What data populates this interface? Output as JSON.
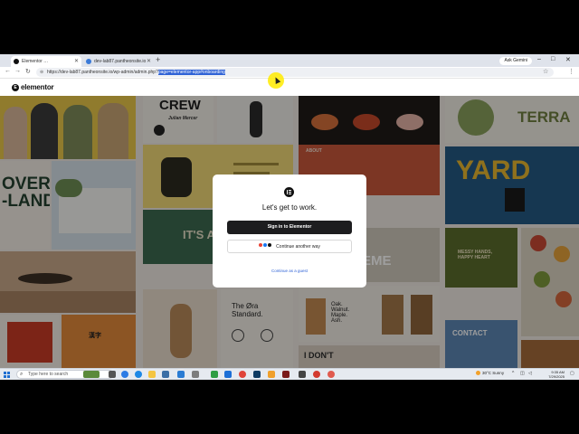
{
  "browser": {
    "tabs": [
      {
        "title": "Elementor …",
        "active": true
      },
      {
        "title": "dev-lab87.pantheonsite.io",
        "active": false
      }
    ],
    "new_tab": "+",
    "gemini_label": "Ask Gemini",
    "url_prefix": "https://dev-lab87.pantheonsite.io/wp-admin/admin.php?",
    "url_selected": "page=elementor-app#onboarding",
    "window_controls": [
      "–",
      "□",
      "✕"
    ],
    "nav": {
      "back": "←",
      "forward": "→",
      "reload": "↻",
      "star": "☆",
      "menu": "⋮"
    }
  },
  "app": {
    "logo_glyph": "E",
    "logo_text": "elementor"
  },
  "mosaic": {
    "texts": {
      "crew": "CREW",
      "crew_name": "Julian Mercer",
      "over_land": "OVER\n-LAND",
      "its_all": "IT'S ALL",
      "about": "ABOUT",
      "eme": "EME",
      "terra": "TERRA",
      "yard": "YARD",
      "messy": "MESSY HANDS,\nHAPPY HEART",
      "contact": "CONTACT",
      "oak": "Oak.\nWalnut.\nMaple.\nAsh.",
      "ora": "The Øra\nStandard.",
      "dont": "I DON'T"
    }
  },
  "modal": {
    "title": "Let's get to work.",
    "primary_button": "Sign in to Elementor",
    "secondary_button": "Continue another way",
    "guest_link": "Continue as a guest"
  },
  "taskbar": {
    "search_placeholder": "Type here to search",
    "weather": "30°C  Sunny",
    "time": "9:35 AM",
    "date": "7/29/2025"
  },
  "colors": {
    "primary_button": "#1d1d1f",
    "link": "#2f62d6",
    "url_selection": "#2f62d6",
    "mouse_highlight": "#ffeb00"
  }
}
